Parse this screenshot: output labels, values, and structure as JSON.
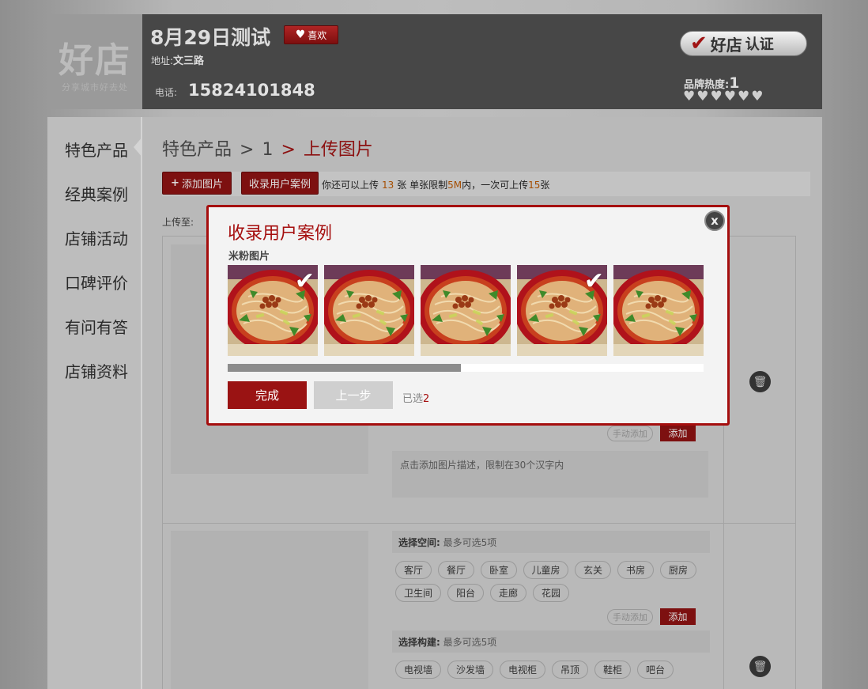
{
  "header": {
    "logo_text": "好店",
    "logo_tagline": "分享城市好去处",
    "title": "8月29日测试",
    "like_label": "喜欢",
    "address_label": "地址:",
    "address_value": "文三路",
    "phone_label": "电话:",
    "phone_value": "15824101848",
    "cert_brand": "好店",
    "cert_label": "认证",
    "heat_label": "品牌热度:",
    "heat_value": "1"
  },
  "sidebar": {
    "items": [
      {
        "label": "特色产品",
        "active": true
      },
      {
        "label": "经典案例"
      },
      {
        "label": "店铺活动"
      },
      {
        "label": "口碑评价"
      },
      {
        "label": "有问有答"
      },
      {
        "label": "店铺资料"
      }
    ]
  },
  "breadcrumb": {
    "root": "特色产品",
    "sep1": ">",
    "mid": "1",
    "sep2": ">",
    "current": "上传图片"
  },
  "toolbar": {
    "add_label": "添加图片",
    "collect_label": "收录用户案例",
    "hint_prefix": "你还可以上传",
    "remaining": "13",
    "hint_unit": "张  单张限制",
    "size_limit": "5M",
    "hint_mid": "内，一次可上传",
    "batch_limit": "15",
    "hint_suffix": "张"
  },
  "upload_to_label": "上传至:",
  "item1": {
    "manual_add": "手动添加",
    "add": "添加",
    "desc_placeholder": "点击添加图片描述，限制在30个汉字内"
  },
  "item2": {
    "space_title": "选择空间:",
    "space_hint": "最多可选5项",
    "space_tags": [
      "客厅",
      "餐厅",
      "卧室",
      "儿童房",
      "玄关",
      "书房",
      "厨房",
      "卫生间",
      "阳台",
      "走廊",
      "花园"
    ],
    "manual_add": "手动添加",
    "add": "添加",
    "build_title": "选择构建:",
    "build_hint": "最多可选5项",
    "build_tags": [
      "电视墙",
      "沙发墙",
      "电视柜",
      "吊顶",
      "鞋柜",
      "吧台"
    ]
  },
  "modal": {
    "title": "收录用户案例",
    "subtitle": "米粉图片",
    "close_label": "x",
    "photos": [
      {
        "checked": true
      },
      {
        "checked": false
      },
      {
        "checked": false
      },
      {
        "checked": true
      },
      {
        "checked": false
      }
    ],
    "scroll_progress": 0.49,
    "done_label": "完成",
    "prev_label": "上一步",
    "selected_label": "已选",
    "selected_count": "2"
  },
  "colors": {
    "accent": "#a50e0e",
    "header_bg": "#474747"
  }
}
